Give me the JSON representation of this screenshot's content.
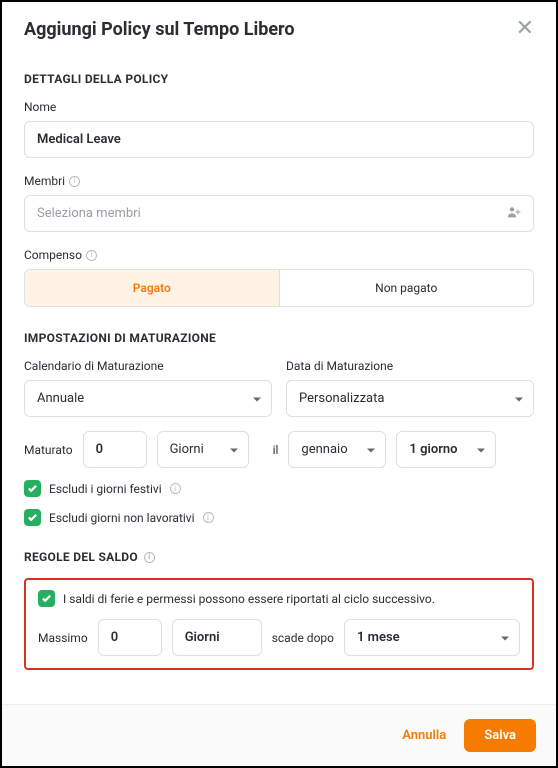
{
  "dialog": {
    "title": "Aggiungi Policy sul Tempo Libero"
  },
  "sections": {
    "details": "DETTAGLI DELLA POLICY",
    "accrual": "IMPOSTAZIONI DI MATURAZIONE",
    "balance": "REGOLE DEL SALDO"
  },
  "policy": {
    "name_label": "Nome",
    "name_value": "Medical Leave",
    "members_label": "Membri",
    "members_placeholder": "Seleziona membri",
    "compensation_label": "Compenso",
    "compensation_options": {
      "paid": "Pagato",
      "unpaid": "Non pagato"
    }
  },
  "accrual": {
    "schedule_label": "Calendario di Maturazione",
    "schedule_value": "Annuale",
    "date_label": "Data di Maturazione",
    "date_value": "Personalizzata",
    "amount_label": "Maturato",
    "amount_value": "0",
    "unit_value": "Giorni",
    "on_label": "il",
    "month_value": "gennaio",
    "day_value": "1 giorno",
    "exclude_holidays": "Escludi i giorni festivi",
    "exclude_nonworking": "Escludi giorni non lavorativi"
  },
  "balance": {
    "carryover_label": "I saldi di ferie e permessi possono essere riportati al ciclo successivo.",
    "max_label": "Massimo",
    "max_value": "0",
    "max_unit": "Giorni",
    "expires_label": "scade dopo",
    "expires_value": "1 mese"
  },
  "footer": {
    "cancel": "Annulla",
    "save": "Salva"
  }
}
